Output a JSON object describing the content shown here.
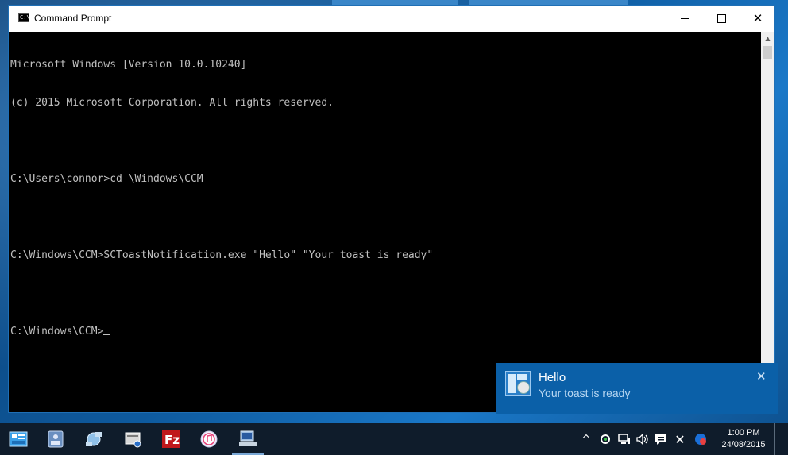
{
  "window": {
    "title": "Command Prompt",
    "icon_text": "C:\\",
    "minimize_icon": "minimize-icon",
    "maximize_icon": "maximize-icon",
    "close_icon": "close-icon"
  },
  "console": {
    "lines": [
      "Microsoft Windows [Version 10.0.10240]",
      "(c) 2015 Microsoft Corporation. All rights reserved.",
      "",
      "C:\\Users\\connor>cd \\Windows\\CCM",
      "",
      "C:\\Windows\\CCM>SCToastNotification.exe \"Hello\" \"Your toast is ready\"",
      "",
      "C:\\Windows\\CCM>"
    ]
  },
  "toast": {
    "title": "Hello",
    "body": "Your toast is ready",
    "close_glyph": "✕",
    "color": "#0b60a8"
  },
  "taskbar": {
    "apps": [
      {
        "name": "start",
        "icon": "windows-icon",
        "color": "#3aa0e8"
      },
      {
        "name": "task-view",
        "icon": "task-view-icon",
        "color": "#6a8fc0"
      },
      {
        "name": "network",
        "icon": "network-icon",
        "color": "#8fc0e8"
      },
      {
        "name": "server",
        "icon": "server-icon",
        "color": "#d8d8d8"
      },
      {
        "name": "filezilla",
        "icon": "filezilla-icon",
        "color": "#c0171b"
      },
      {
        "name": "itunes",
        "icon": "itunes-icon",
        "color": "#e8e8f8"
      },
      {
        "name": "command-prompt",
        "icon": "computer-icon",
        "color": "#9bbbe0"
      }
    ],
    "tray": {
      "chevron": "^",
      "clock_time": "1:00 PM",
      "clock_date": "24/08/2015"
    }
  },
  "colors": {
    "console_text": "#c0c0c0",
    "taskbar": "#0f1c2b"
  }
}
